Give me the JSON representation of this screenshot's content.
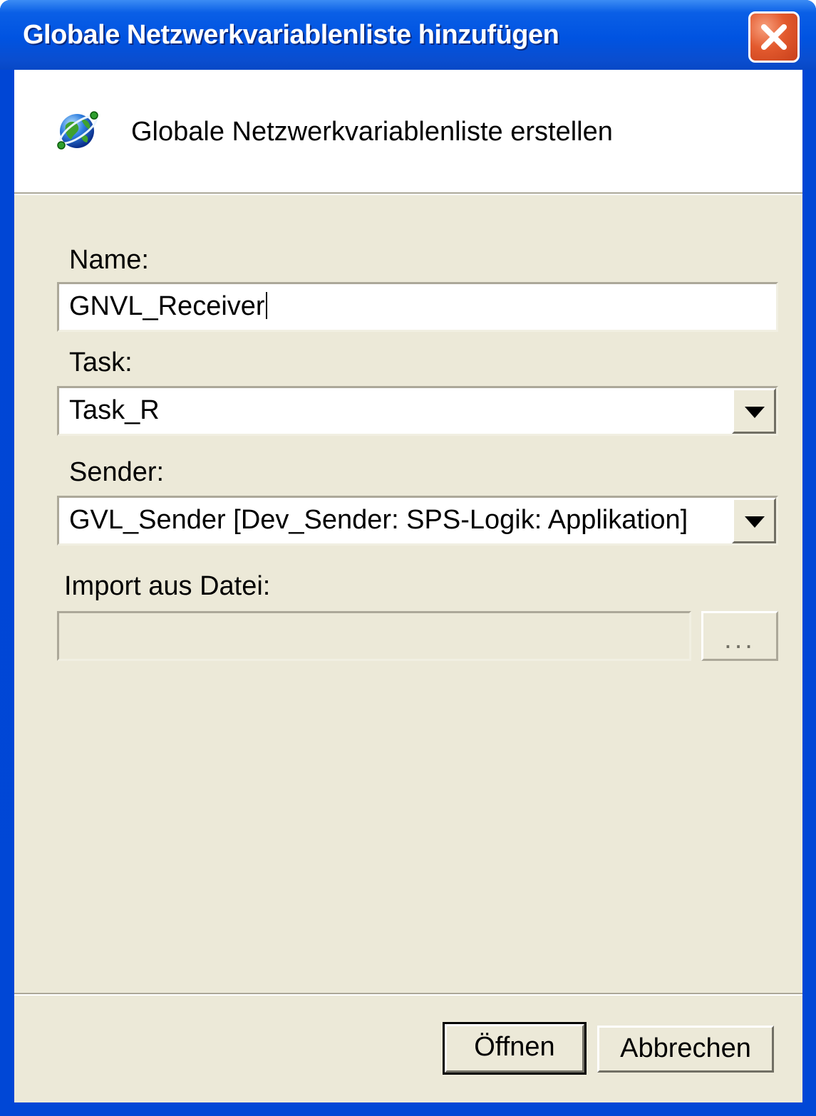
{
  "window": {
    "title": "Globale Netzwerkvariablenliste hinzufügen"
  },
  "header": {
    "icon": "globe-network-icon",
    "text": "Globale Netzwerkvariablenliste erstellen"
  },
  "form": {
    "name_label": "Name:",
    "name_value": "GNVL_Receiver",
    "task_label": "Task:",
    "task_value": "Task_R",
    "sender_label": "Sender:",
    "sender_value": "GVL_Sender [Dev_Sender: SPS-Logik: Applikation]",
    "import_label": "Import aus Datei:",
    "import_value": "",
    "browse_label": "..."
  },
  "footer": {
    "open_label": "Öffnen",
    "cancel_label": "Abbrechen"
  },
  "colors": {
    "titlebar": "#0053e1",
    "dialog_bg": "#ece9d8",
    "close_button": "#e35a2e"
  }
}
